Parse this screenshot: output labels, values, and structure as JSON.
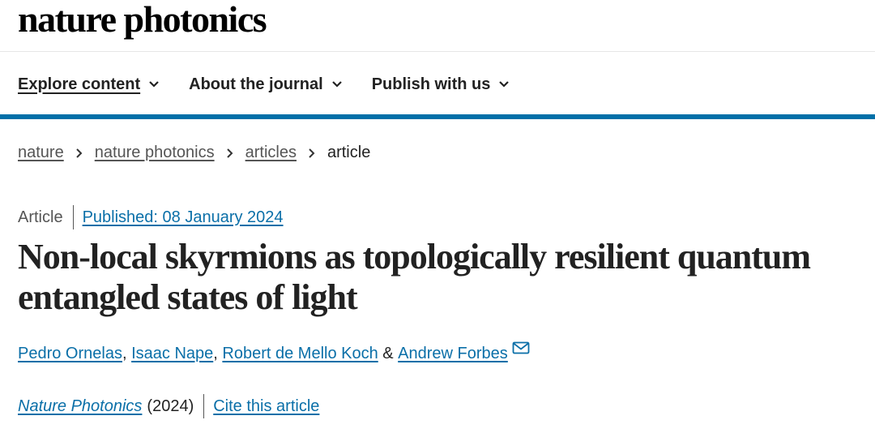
{
  "header": {
    "brand": "nature photonics"
  },
  "nav": {
    "items": [
      {
        "label": "Explore content"
      },
      {
        "label": "About the journal"
      },
      {
        "label": "Publish with us"
      }
    ]
  },
  "breadcrumb": {
    "items": [
      "nature",
      "nature photonics",
      "articles"
    ],
    "current": "article"
  },
  "article": {
    "type": "Article",
    "published": "Published: 08 January 2024",
    "title": "Non-local skyrmions as topologically resilient quantum entangled states of light",
    "authors": [
      "Pedro Ornelas",
      "Isaac Nape",
      "Robert de Mello Koch",
      "Andrew Forbes"
    ],
    "author_sep_comma": ", ",
    "author_sep_and": " & ",
    "journal": "Nature Photonics",
    "year": "(2024)",
    "cite_label": "Cite this article"
  },
  "colors": {
    "accent_bar": "#0070a8",
    "link": "#0a6fa8",
    "text": "#222222"
  }
}
